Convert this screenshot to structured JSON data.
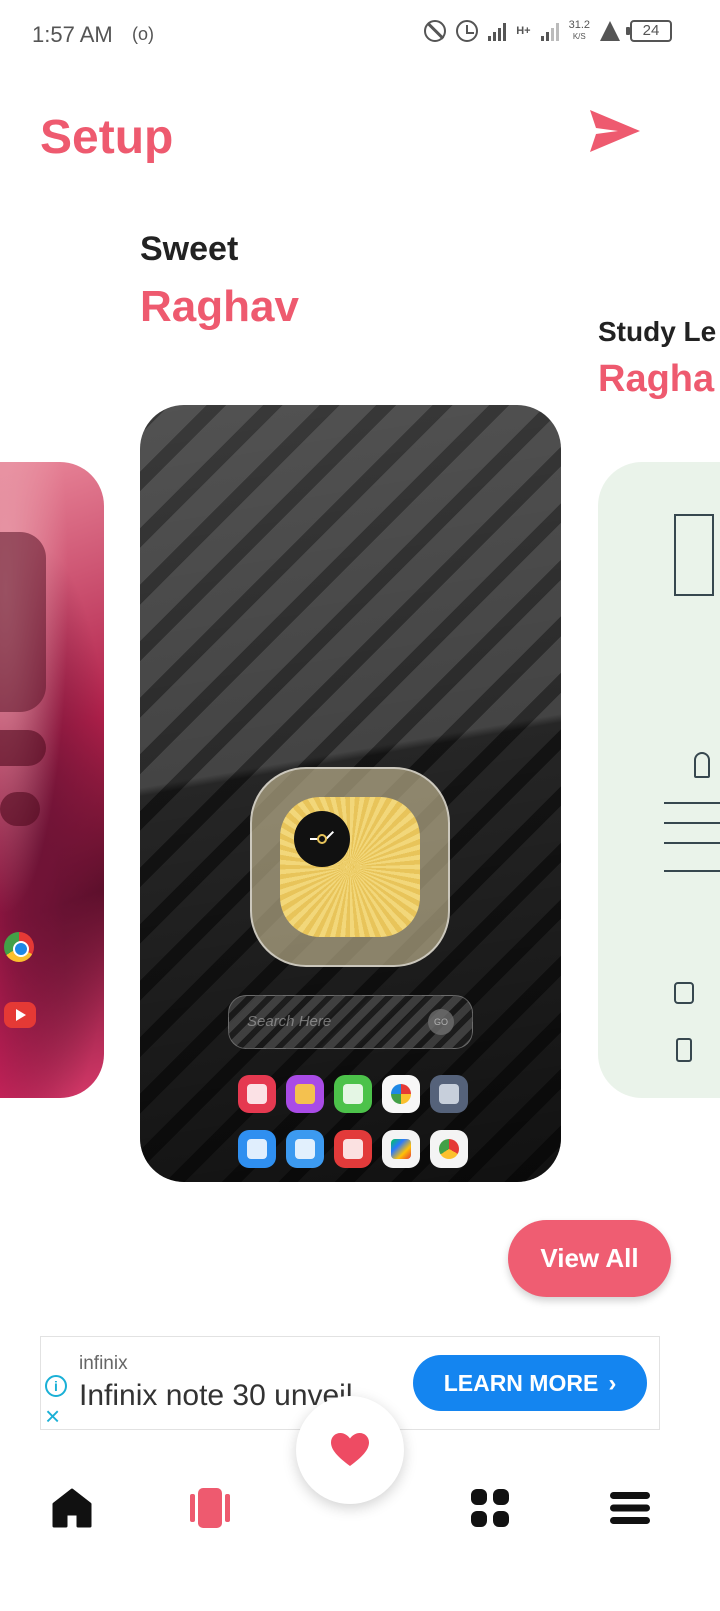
{
  "status_bar": {
    "time": "1:57 AM",
    "network_type": "H+",
    "speed_value": "31.2",
    "speed_unit": "K/S",
    "battery": "24"
  },
  "header": {
    "title": "Setup",
    "send_icon": "send-icon"
  },
  "cards": {
    "main": {
      "subtitle": "Sweet",
      "author": "Raghav",
      "search_placeholder": "Search Here",
      "search_button": "GO"
    },
    "right": {
      "subtitle": "Study Le",
      "author": "Ragha"
    }
  },
  "actions": {
    "view_all": "View All"
  },
  "ad": {
    "brand": "infinix",
    "headline": "Infinix note 30 unveil",
    "cta": "LEARN MORE"
  },
  "bottom_nav": {
    "items": [
      "home-icon",
      "cards-icon",
      "favorites-icon",
      "grid-icon",
      "menu-icon"
    ]
  },
  "colors": {
    "accent": "#ee5a6f",
    "ad_cta": "#1485f0",
    "ad_info": "#1ab0d6"
  }
}
